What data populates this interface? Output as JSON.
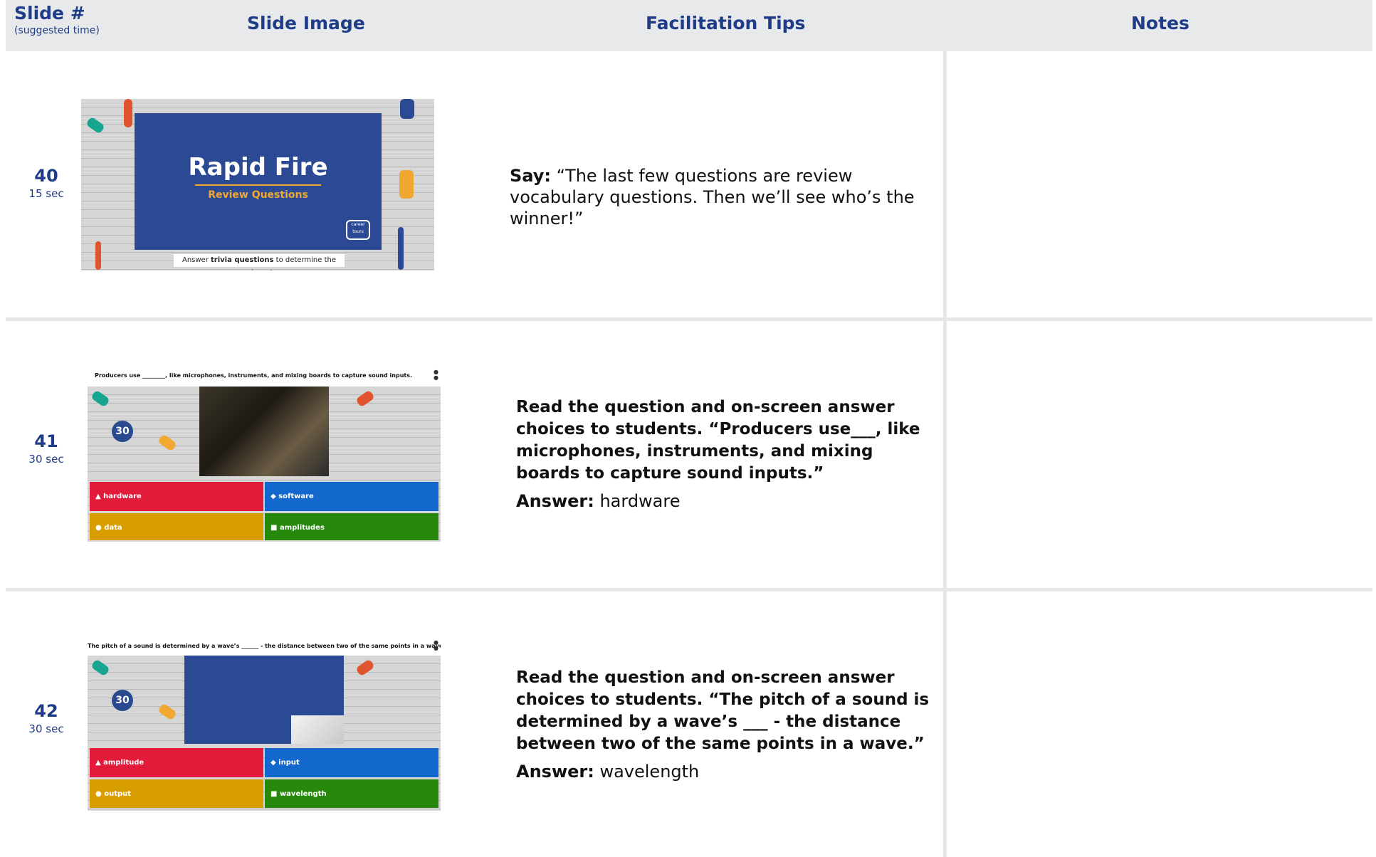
{
  "header": {
    "slide_col": "Slide #",
    "slide_col_sub": "(suggested time)",
    "image_col": "Slide Image",
    "tips_col": "Facilitation Tips",
    "notes_col": "Notes"
  },
  "rows": [
    {
      "number": "40",
      "time": "15 sec",
      "slide": {
        "title": "Rapid Fire",
        "subtitle": "Review Questions",
        "caption_pre": "Answer ",
        "caption_bold": "trivia questions",
        "caption_post": " to determine the winner!",
        "logo_top": "career",
        "logo_bottom": "tours"
      },
      "tips": {
        "lead": "Say:",
        "text": " “The last few questions are review vocabulary questions. Then we’ll see who’s the winner!”"
      }
    },
    {
      "number": "41",
      "time": "30 sec",
      "slide": {
        "question": "Producers use ________, like microphones, instruments, and mixing boards to capture sound inputs.",
        "timer": "30",
        "answers": [
          "hardware",
          "software",
          "data",
          "amplitudes"
        ]
      },
      "tips": {
        "question": "Read the question and on-screen answer choices to students. “Producers use___, like microphones, instruments, and mixing boards to capture sound inputs.”",
        "answer_label": "Answer:",
        "answer": " hardware"
      }
    },
    {
      "number": "42",
      "time": "30 sec",
      "slide": {
        "question": "The pitch of a sound is determined by a wave’s ______ - the distance between two of the same points in a wave.",
        "timer": "30",
        "answers": [
          "amplitude",
          "input",
          "output",
          "wavelength"
        ]
      },
      "tips": {
        "question": "Read the question and on-screen answer choices to students. “The pitch of a sound is determined by a wave’s ___ - the distance between two of the same points in a wave.”",
        "answer_label": "Answer:",
        "answer": " wavelength"
      }
    }
  ],
  "colors": {
    "accent": "#1f3c88",
    "header_bg": "#e8e9eb",
    "answer_red": "#e31b3b",
    "answer_blue": "#1368ce",
    "answer_gold": "#d89e00",
    "answer_green": "#26890c"
  }
}
